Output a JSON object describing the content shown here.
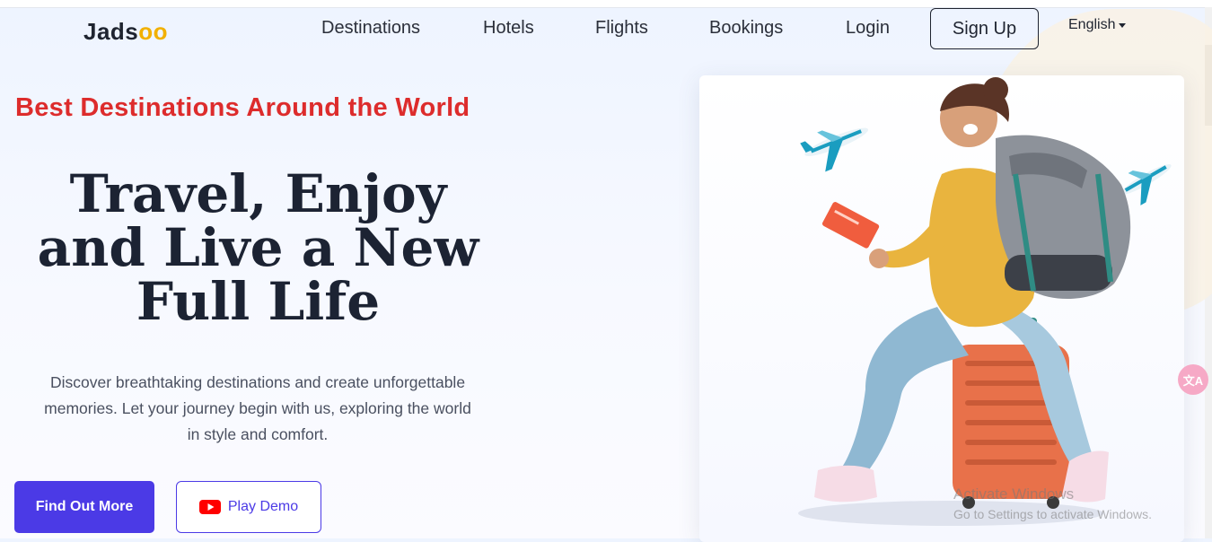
{
  "brand": {
    "logo_main": "Jads",
    "logo_accent": "oo"
  },
  "nav": {
    "links": [
      "Destinations",
      "Hotels",
      "Flights",
      "Bookings",
      "Login"
    ],
    "signup_label": "Sign Up",
    "language": "English"
  },
  "hero": {
    "tagline": "Best Destinations Around the World",
    "title_lines": [
      "Travel, Enjoy",
      "and Live a New",
      "Full Life"
    ],
    "description": "Discover breathtaking destinations and create unforgettable memories. Let your journey begin with us, exploring the world in style and comfort.",
    "primary_button": "Find Out More",
    "demo_button": "Play Demo"
  },
  "overlay": {
    "translate_icon_text": "文A",
    "watermark_line1": "Activate Windows",
    "watermark_line2": "Go to Settings to activate Windows."
  },
  "colors": {
    "accent_yellow": "#f2b000",
    "tagline_red": "#dd2c2c",
    "primary_purple": "#4b3ae6",
    "heading_dark": "#1c2333"
  },
  "icons": [
    "caret-down-icon",
    "youtube-play-icon",
    "airplane-icon",
    "translate-icon"
  ]
}
